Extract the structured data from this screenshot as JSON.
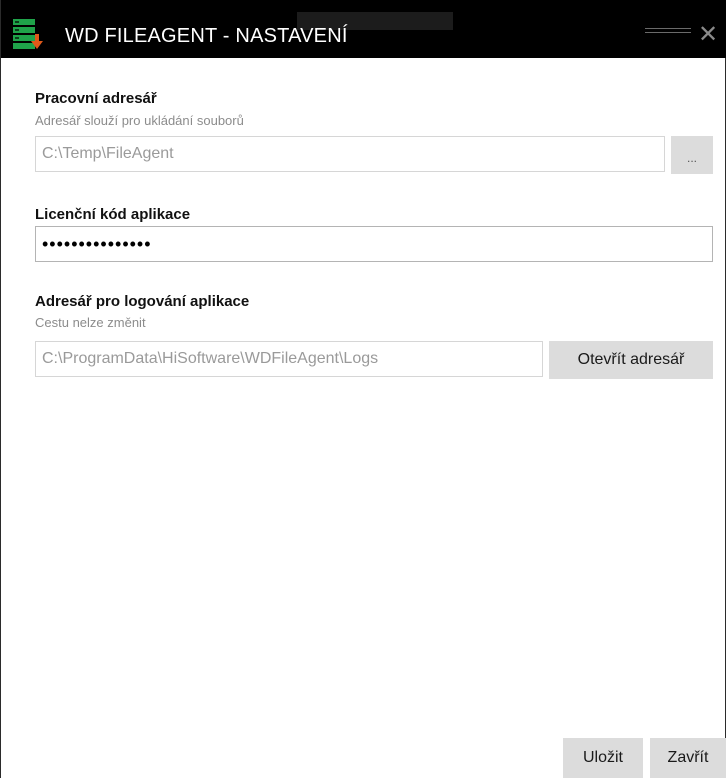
{
  "window": {
    "title": "WD FILEAGENT - NASTAVENÍ",
    "close_glyph": "✕",
    "icon": "server-download-icon",
    "accent": "#1fa34a",
    "download_accent": "#e0591a"
  },
  "working_dir": {
    "label": "Pracovní adresář",
    "hint": "Adresář slouží pro ukládání souborů",
    "value": "C:\\Temp\\FileAgent",
    "browse_label": "..."
  },
  "license": {
    "label": "Licenční kód aplikace",
    "masked_value": "•••••••••••••••"
  },
  "log_dir": {
    "label": "Adresář pro logování aplikace",
    "hint": "Cestu nelze změnit",
    "value": "C:\\ProgramData\\HiSoftware\\WDFileAgent\\Logs",
    "open_label": "Otevřít adresář"
  },
  "footer": {
    "save_label": "Uložit",
    "close_label": "Zavřít"
  }
}
